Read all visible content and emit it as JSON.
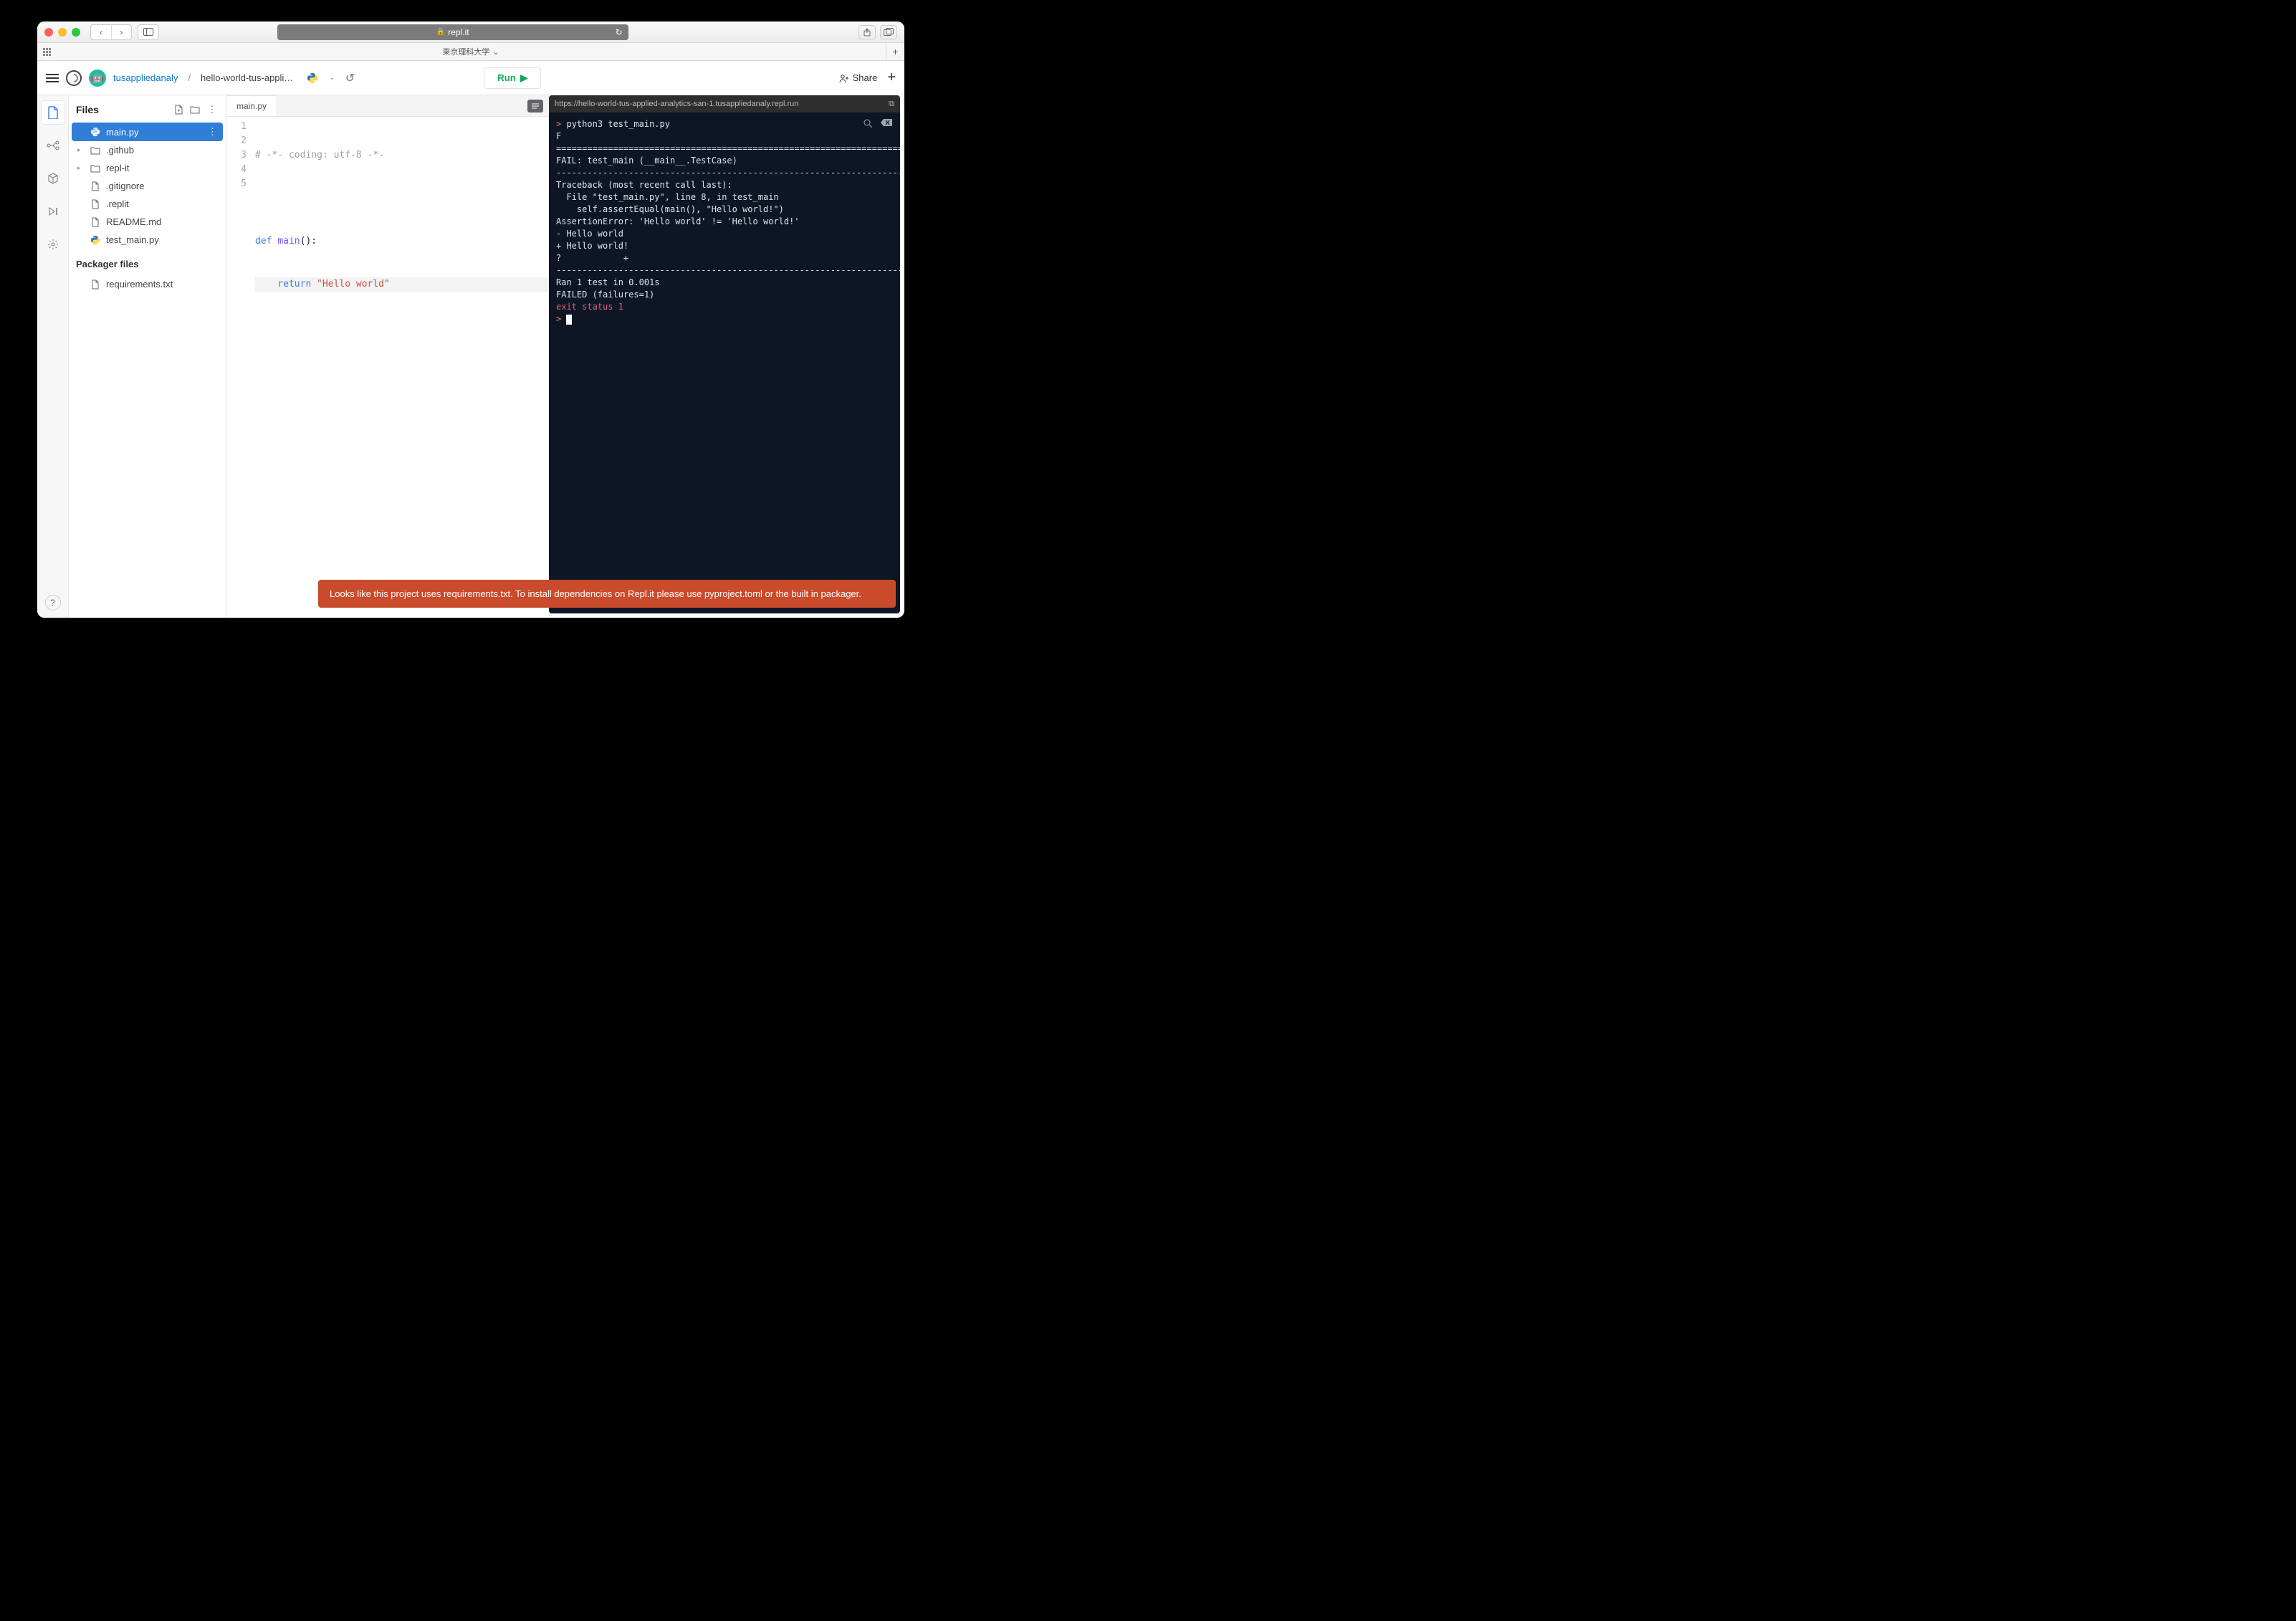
{
  "browser": {
    "url": "repl.it",
    "bookmark_label": "東京理科大学"
  },
  "header": {
    "user": "tusappliedanaly",
    "project": "hello-world-tus-appli…",
    "run_label": "Run",
    "share_label": "Share"
  },
  "rail": {
    "help": "?"
  },
  "files": {
    "title": "Files",
    "items": [
      {
        "name": "main.py",
        "type": "py",
        "active": true
      },
      {
        "name": ".github",
        "type": "folder"
      },
      {
        "name": "repl-it",
        "type": "folder"
      },
      {
        "name": ".gitignore",
        "type": "file"
      },
      {
        "name": ".replit",
        "type": "file"
      },
      {
        "name": "README.md",
        "type": "file"
      },
      {
        "name": "test_main.py",
        "type": "py"
      }
    ],
    "section": "Packager files",
    "packager": [
      {
        "name": "requirements.txt",
        "type": "file"
      }
    ]
  },
  "editor": {
    "tab": "main.py",
    "lines": {
      "l1_comment": "# -*- coding: utf-8 -*-",
      "l3_kw": "def ",
      "l3_fn": "main",
      "l3_rest": "():",
      "l4_kw": "    return ",
      "l4_str": "\"Hello world\""
    }
  },
  "console": {
    "url": "https://hello-world-tus-applied-analytics-san-1.tusappliedanaly.repl.run",
    "cmd": "python3 test_main.py",
    "lines": [
      "F",
      "======================================================================",
      "FAIL: test_main (__main__.TestCase)",
      "----------------------------------------------------------------------",
      "Traceback (most recent call last):",
      "  File \"test_main.py\", line 8, in test_main",
      "    self.assertEqual(main(), \"Hello world!\")",
      "AssertionError: 'Hello world' != 'Hello world!'",
      "- Hello world",
      "+ Hello world!",
      "?            +",
      "",
      "",
      "----------------------------------------------------------------------",
      "Ran 1 test in 0.001s",
      "",
      "FAILED (failures=1)"
    ],
    "exit": "exit status 1"
  },
  "toast": "Looks like this project uses requirements.txt. To install dependencies on Repl.it please use pyproject.toml or the built in packager."
}
